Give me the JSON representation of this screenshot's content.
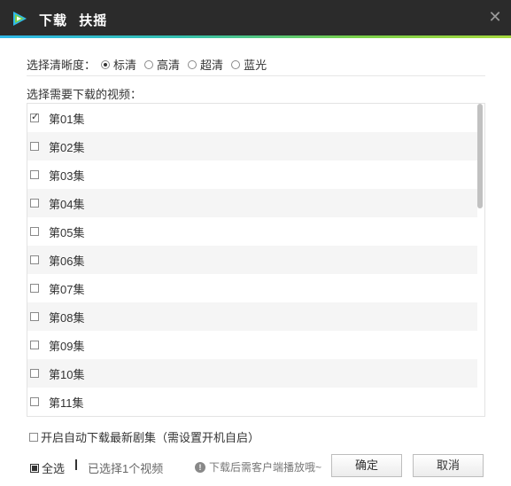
{
  "titlebar": {
    "title_main": "下载",
    "title_show": "扶摇",
    "close_glyph": "✕",
    "accent_colors": [
      "#2fb8e8",
      "#7ad04a"
    ]
  },
  "quality": {
    "label": "选择清晰度：",
    "options": [
      {
        "label": "标清",
        "checked": true
      },
      {
        "label": "高清",
        "checked": false
      },
      {
        "label": "超清",
        "checked": false
      },
      {
        "label": "蓝光",
        "checked": false
      }
    ]
  },
  "list_label": "选择需要下载的视频：",
  "episodes": [
    {
      "label": "第01集",
      "checked": true
    },
    {
      "label": "第02集",
      "checked": false
    },
    {
      "label": "第03集",
      "checked": false
    },
    {
      "label": "第04集",
      "checked": false
    },
    {
      "label": "第05集",
      "checked": false
    },
    {
      "label": "第06集",
      "checked": false
    },
    {
      "label": "第07集",
      "checked": false
    },
    {
      "label": "第08集",
      "checked": false
    },
    {
      "label": "第09集",
      "checked": false
    },
    {
      "label": "第10集",
      "checked": false
    },
    {
      "label": "第11集",
      "checked": false
    }
  ],
  "auto_download": {
    "label": "开启自动下载最新剧集（需设置开机自启）",
    "checked": false
  },
  "footer": {
    "select_all_label": "全选",
    "selected_count_text": "已选择1个视频",
    "info_icon": "!",
    "info_text": "下载后需客户端播放哦~",
    "ok_label": "确定",
    "cancel_label": "取消"
  }
}
